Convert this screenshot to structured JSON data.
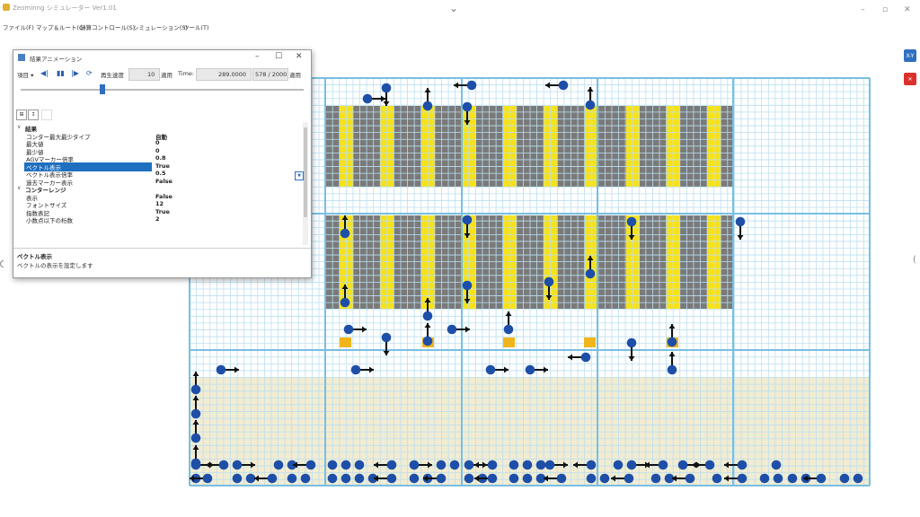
{
  "app": {
    "title": "Zeominng シミュレーター Ver1.01",
    "top_glyph": "⌄",
    "minimize": "–",
    "maximize": "▫",
    "close": "✕"
  },
  "menu": [
    "ファイル(F)",
    "マップ＆ルート(G)",
    "計算コントロール(S)",
    "シミュレーション(S)",
    "ツール(T)"
  ],
  "side_buttons": {
    "xy": "X-Y",
    "close": "✕"
  },
  "dialog": {
    "title": "結果アニメーション",
    "minimize": "–",
    "maximize": "☐",
    "close": "✕",
    "toolbar": {
      "item_menu": "項目 ▾",
      "step_back": "◀|",
      "pause": "▮▮",
      "step_forward": "|▶",
      "loop": "⟳",
      "speed_label": "再生速度",
      "speed_value": "10",
      "apply": "適用",
      "time_label": "Time:",
      "time_value": "289.0000",
      "frame_value": "578 / 2000",
      "apply2": "適用"
    },
    "slider_position": 0.29,
    "property_rows": [
      {
        "kind": "category",
        "name": "結果"
      },
      {
        "kind": "prop",
        "name": "コンター最大最少タイプ",
        "value": "自動"
      },
      {
        "kind": "prop",
        "name": "最大値",
        "value": "0"
      },
      {
        "kind": "prop",
        "name": "最少値",
        "value": "0"
      },
      {
        "kind": "prop",
        "name": "AGVマーカー倍率",
        "value": "0.8"
      },
      {
        "kind": "prop",
        "name": "ベクトル表示",
        "value": "True",
        "selected": true
      },
      {
        "kind": "prop",
        "name": "ベクトル表示倍率",
        "value": "0.5"
      },
      {
        "kind": "prop",
        "name": "過去マーカー表示",
        "value": "False"
      },
      {
        "kind": "category",
        "name": "コンターレンジ"
      },
      {
        "kind": "prop",
        "name": "表示",
        "value": "False"
      },
      {
        "kind": "prop",
        "name": "フォントサイズ",
        "value": "12"
      },
      {
        "kind": "prop",
        "name": "指数表記",
        "value": "True"
      },
      {
        "kind": "prop",
        "name": "小数点以下の桁数",
        "value": "2"
      }
    ],
    "description": {
      "title": "ベクトル表示",
      "text": "ベクトルの表示を設定します"
    }
  },
  "colors": {
    "grid_line": "#bcdff0",
    "grid_major": "#78bfe2",
    "rack_dark": "#7a7a7a",
    "rack_yellow": "#f7e21a",
    "floor_tan": "#f1ecd2",
    "agv": "#1e4fa8",
    "arrow": "#111111",
    "station": "#f1b51c",
    "btn_blue": "#2f6fc0",
    "btn_red": "#d9322d"
  }
}
